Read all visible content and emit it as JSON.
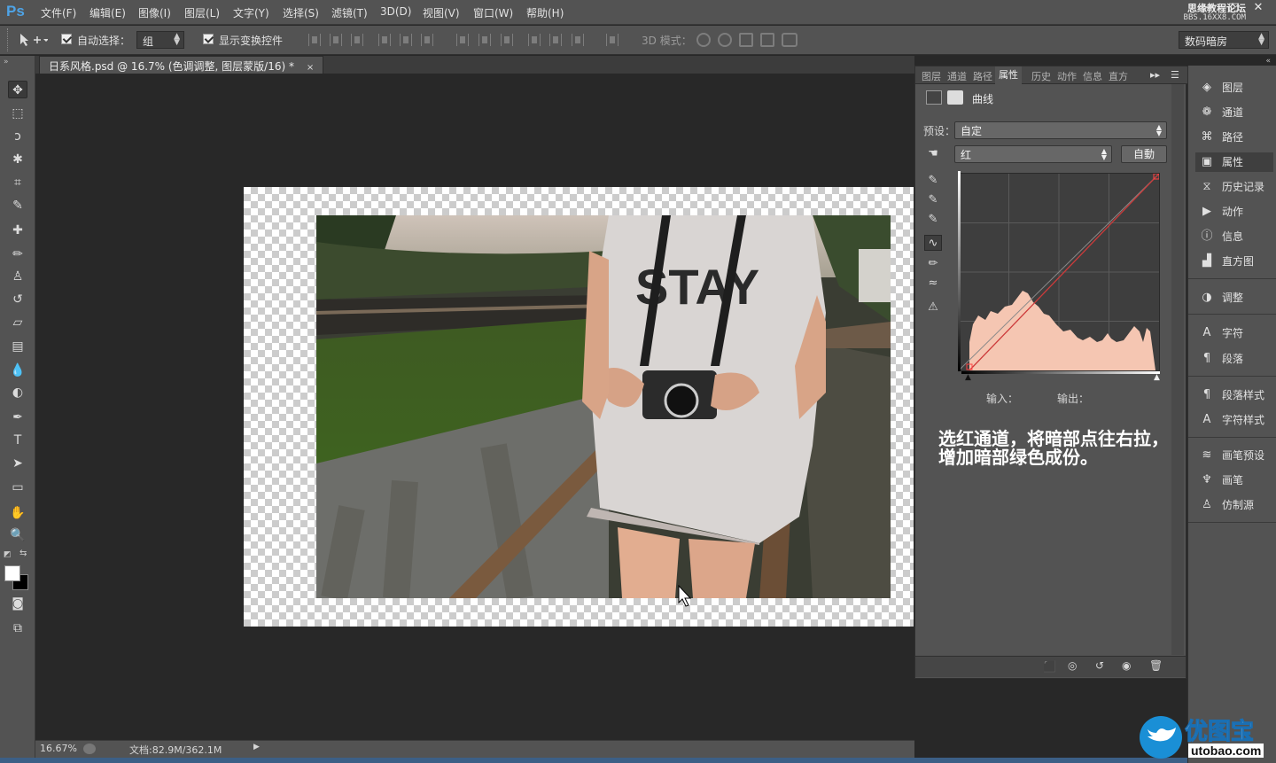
{
  "app": {
    "logo": "Ps"
  },
  "menus": [
    "文件(F)",
    "编辑(E)",
    "图像(I)",
    "图层(L)",
    "文字(Y)",
    "选择(S)",
    "滤镜(T)",
    "3D(D)",
    "视图(V)",
    "窗口(W)",
    "帮助(H)"
  ],
  "window_buttons": [
    "–",
    "□",
    "✕"
  ],
  "watermark_top": {
    "line1": "思缘教程论坛",
    "line2": "BBS.16XX8.COM"
  },
  "options_bar": {
    "auto_select_label": "自动选择：",
    "auto_select_checked": true,
    "auto_select_value": "组",
    "show_transform_label": "显示变换控件",
    "show_transform_checked": true,
    "mode_3d_label": "3D 模式：",
    "workspace_value": "数码暗房"
  },
  "document": {
    "tab_title": "日系风格.psd @ 16.7% (色调调整, 图层蒙版/16) *",
    "close": "×",
    "photo_shirt_text": "STAY"
  },
  "status_bar": {
    "zoom": "16.67%",
    "doc_info": "文档:82.9M/362.1M"
  },
  "panel": {
    "tabs": [
      "图层",
      "通道",
      "路径",
      "属性",
      "历史",
      "动作",
      "信息",
      "直方"
    ],
    "active_tab": "属性",
    "title": "曲线",
    "preset_label": "预设：",
    "preset_value": "自定",
    "channel_value": "红",
    "auto_button": "自動",
    "input_label": "输入：",
    "output_label": "输出：",
    "curve_color": "#cc3a3a",
    "histogram_color": "#f5c6b2",
    "annotation": "选红通道，将暗部点往右拉，增加暗部绿色成份。"
  },
  "dock": [
    {
      "icon": "layers-icon",
      "label": "图层"
    },
    {
      "icon": "channels-icon",
      "label": "通道"
    },
    {
      "icon": "paths-icon",
      "label": "路径"
    },
    {
      "icon": "properties-icon",
      "label": "属性",
      "active": true
    },
    {
      "icon": "history-icon",
      "label": "历史记录"
    },
    {
      "icon": "actions-icon",
      "label": "动作"
    },
    {
      "icon": "info-icon",
      "label": "信息"
    },
    {
      "icon": "histogram-icon",
      "label": "直方图"
    },
    {
      "icon": "adjustments-icon",
      "label": "调整"
    },
    {
      "icon": "character-icon",
      "label": "字符"
    },
    {
      "icon": "paragraph-icon",
      "label": "段落"
    },
    {
      "icon": "paragraph-styles-icon",
      "label": "段落样式"
    },
    {
      "icon": "character-styles-icon",
      "label": "字符样式"
    },
    {
      "icon": "brush-presets-icon",
      "label": "画笔预设"
    },
    {
      "icon": "brush-icon",
      "label": "画笔"
    },
    {
      "icon": "clone-source-icon",
      "label": "仿制源"
    }
  ],
  "watermark_bottom": {
    "brand": "优图宝",
    "url": "utobao.com"
  }
}
